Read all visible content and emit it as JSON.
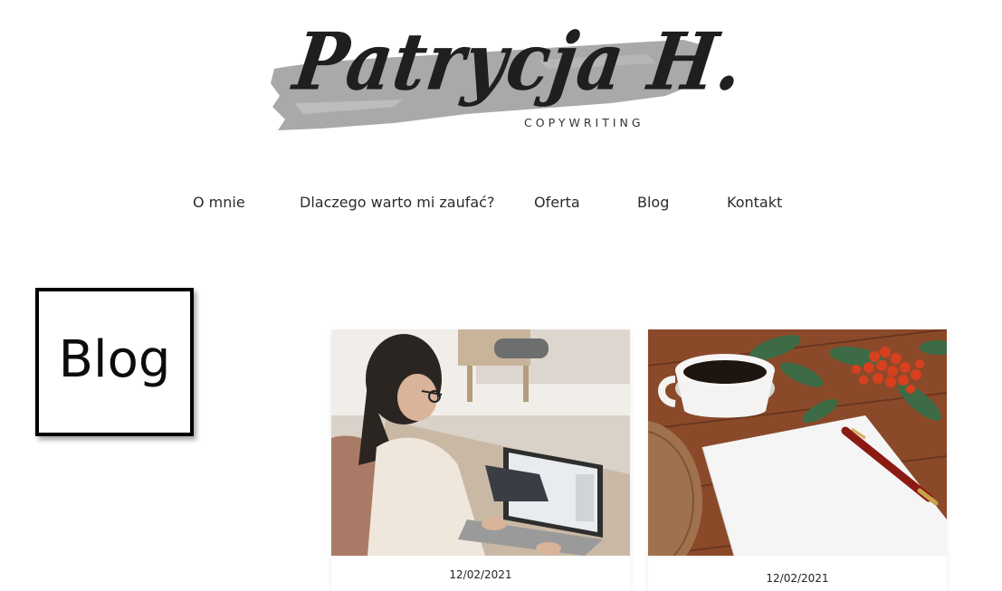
{
  "logo": {
    "name": "Patrycja H.",
    "tagline": "COPYWRITING"
  },
  "nav": {
    "items": [
      {
        "label": "O mnie"
      },
      {
        "label": "Dlaczego warto mi zaufać?"
      },
      {
        "label": "Oferta"
      },
      {
        "label": "Blog"
      },
      {
        "label": "Kontakt"
      }
    ]
  },
  "page": {
    "title": "Blog"
  },
  "posts": [
    {
      "date": "12/02/2021",
      "image": "woman-working-on-laptop-photo"
    },
    {
      "date": "12/02/2021",
      "image": "coffee-cup-paper-and-pen-photo"
    }
  ],
  "colors": {
    "brush": "#a9a9a9",
    "text": "#222222",
    "border": "#000000"
  }
}
